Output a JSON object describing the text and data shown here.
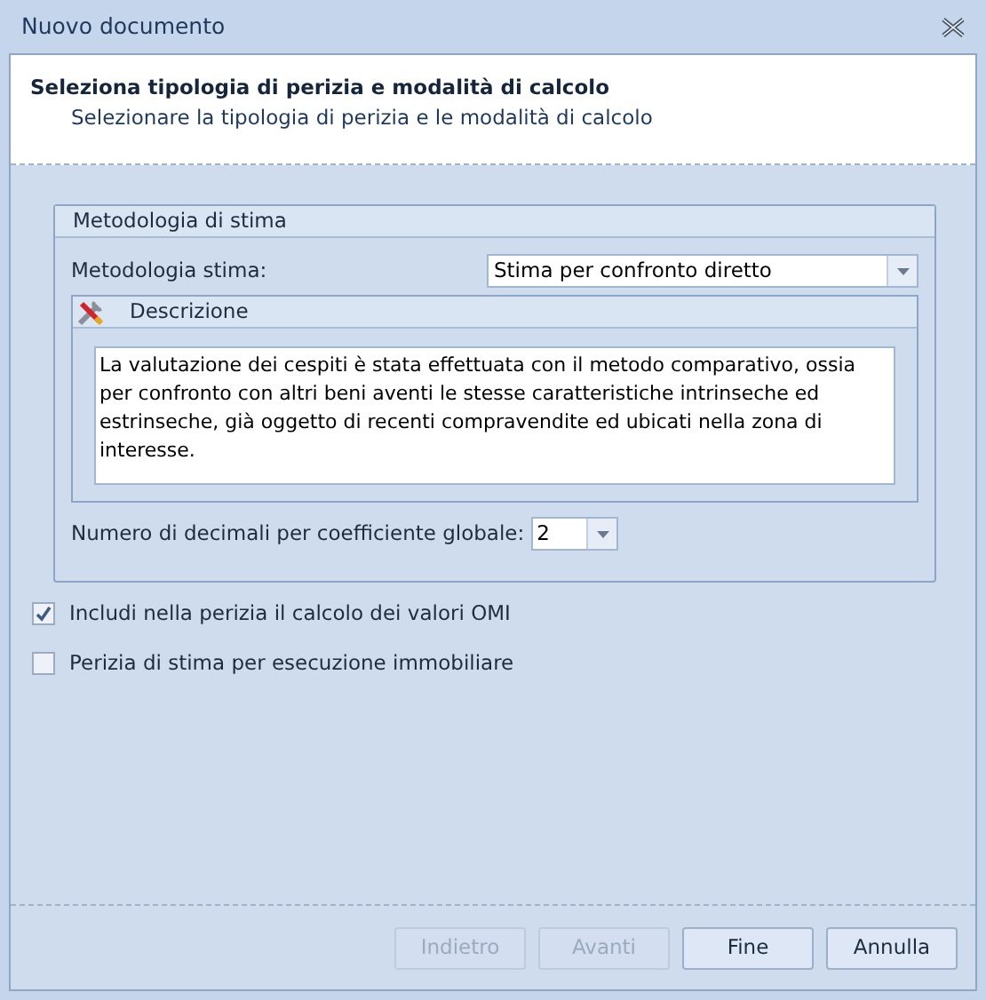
{
  "window": {
    "title": "Nuovo documento"
  },
  "header": {
    "title": "Seleziona tipologia di perizia e modalità di calcolo",
    "subtitle": "Selezionare la tipologia di perizia e le modalità di calcolo"
  },
  "group": {
    "title": "Metodologia di stima",
    "method_label": "Metodologia stima:",
    "method_value": "Stima per confronto diretto",
    "description_title": "Descrizione",
    "description": "La valutazione dei cespiti è stata effettuata con il metodo comparativo, ossia per confronto con altri beni aventi le stesse caratteristiche intrinseche ed estrinseche, già oggetto di recenti compravendite ed ubicati nella zona di interesse.",
    "decimals_label": "Numero di decimali per coefficiente globale:",
    "decimals_value": "2"
  },
  "options": [
    {
      "label": "Includi nella perizia il calcolo dei valori OMI",
      "checked": true
    },
    {
      "label": "Perizia di stima per esecuzione immobiliare",
      "checked": false
    }
  ],
  "buttons": [
    {
      "label": "Indietro",
      "disabled": true
    },
    {
      "label": "Avanti",
      "disabled": true
    },
    {
      "label": "Fine",
      "disabled": false
    },
    {
      "label": "Annulla",
      "disabled": false
    }
  ]
}
